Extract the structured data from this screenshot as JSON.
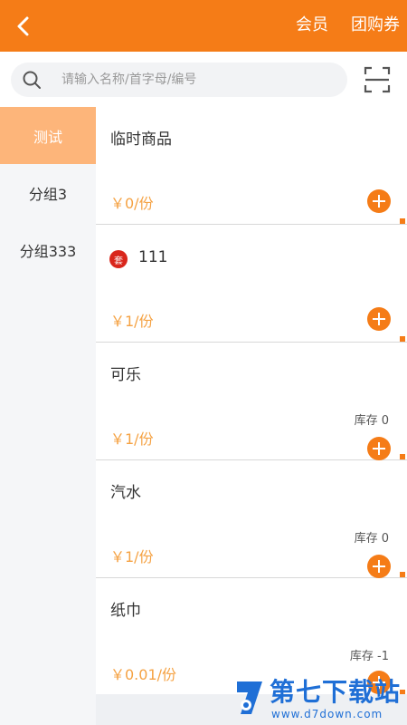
{
  "header": {
    "back_icon": "chevron-left-icon",
    "member_label": "会员",
    "coupon_label": "团购券",
    "bg_color": "#f57c17"
  },
  "search": {
    "placeholder": "请输入名称/首字母/编号",
    "icon": "search-icon",
    "scan_icon": "scan-icon"
  },
  "sidebar": {
    "categories": [
      {
        "label": "测试",
        "active": true
      },
      {
        "label": "分组3",
        "active": false
      },
      {
        "label": "分组333",
        "active": false
      }
    ]
  },
  "products": [
    {
      "name": "临时商品",
      "price": "￥0/份",
      "stock": "",
      "badge": ""
    },
    {
      "name": "111",
      "price": "￥1/份",
      "stock": "",
      "badge": "套"
    },
    {
      "name": "可乐",
      "price": "￥1/份",
      "stock": "库存 0",
      "badge": ""
    },
    {
      "name": "汽水",
      "price": "￥1/份",
      "stock": "库存 0",
      "badge": ""
    },
    {
      "name": "纸巾",
      "price": "￥0.01/份",
      "stock": "库存 -1",
      "badge": ""
    }
  ],
  "watermark": {
    "title": "第七下载站",
    "url": "www.d7down.com"
  },
  "colors": {
    "accent": "#f57c17",
    "price": "#f5a243",
    "active_category": "#fdb57a",
    "badge": "#d9261c"
  }
}
